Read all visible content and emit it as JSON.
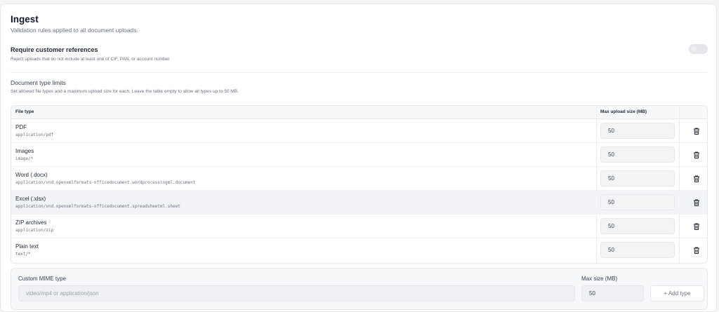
{
  "section": {
    "title": "Ingest",
    "description": "Validation rules applied to all document uploads."
  },
  "require_refs": {
    "title": "Require customer references",
    "description": "Reject uploads that do not include at least one of CIF, PAN, or account number.",
    "enabled": false
  },
  "limits": {
    "title": "Document type limits",
    "description": "Set allowed file types and a maximum upload size for each. Leave the table empty to allow all types up to 50 MB.",
    "columns": {
      "file_type": "File type",
      "max_size": "Max upload size (MB)"
    },
    "rows": [
      {
        "name": "PDF",
        "mime": "application/pdf",
        "max_mb": "50"
      },
      {
        "name": "Images",
        "mime": "image/*",
        "max_mb": "50"
      },
      {
        "name": "Word (.docx)",
        "mime": "application/vnd.openxmlformats-officedocument.wordprocessingml.document",
        "max_mb": "50"
      },
      {
        "name": "Excel (.xlsx)",
        "mime": "application/vnd.openxmlformats-officedocument.spreadsheetml.sheet",
        "max_mb": "50"
      },
      {
        "name": "ZIP archives",
        "mime": "application/zip",
        "max_mb": "50"
      },
      {
        "name": "Plain text",
        "mime": "text/*",
        "max_mb": "50"
      }
    ]
  },
  "add": {
    "mime_label": "Custom MIME type",
    "mime_placeholder": "video/mp4 or application/json",
    "size_label": "Max size (MB)",
    "size_value": "50",
    "button_label": "+ Add type"
  },
  "icons": {
    "delete": "trash-icon"
  },
  "colors": {
    "accent": "#111827",
    "muted": "#6b7280",
    "row_highlight": "#f1f3f6"
  }
}
